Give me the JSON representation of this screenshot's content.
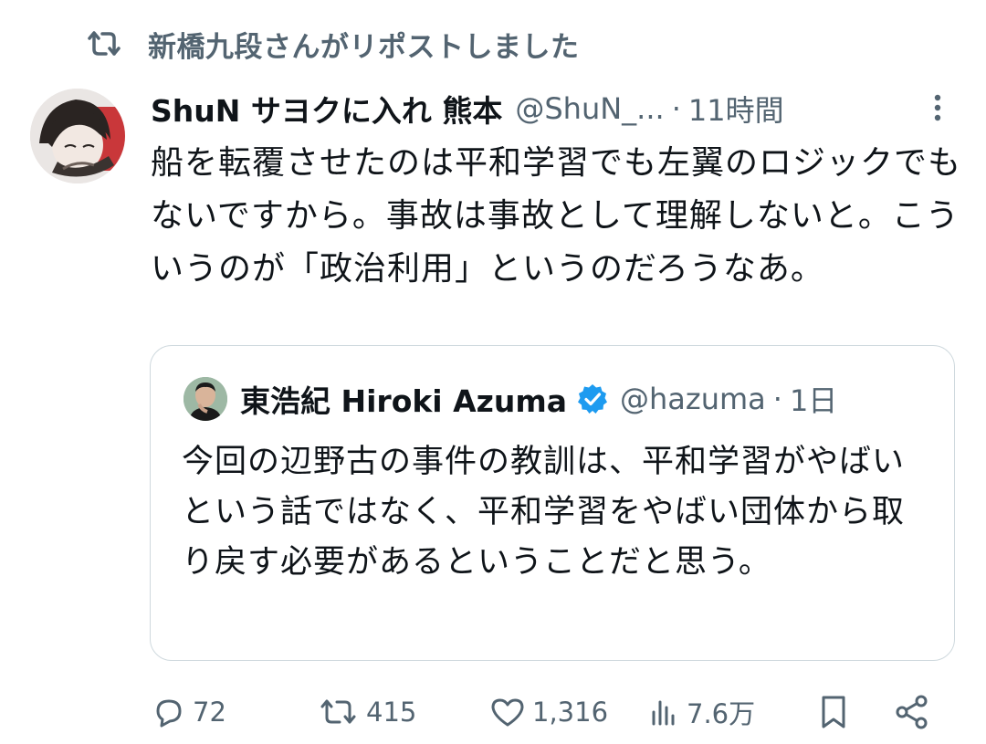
{
  "repost": {
    "icon": "repost-icon",
    "text": "新橋九段さんがリポストしました"
  },
  "tweet": {
    "display_name": "ShuN サヨクに入れ 熊本",
    "handle": "@ShuN_...",
    "separator": "·",
    "time": "11時間",
    "text": "船を転覆させたのは平和学習でも左翼のロジックでもないですから。事故は事故として理解しないと。こういうのが「政治利用」というのだろうなあ。"
  },
  "quote": {
    "display_name": "東浩紀 Hiroki Azuma",
    "verified": true,
    "handle": "@hazuma",
    "separator": "·",
    "time": "1日",
    "text": "今回の辺野古の事件の教訓は、平和学習がやばいという話ではなく、平和学習をやばい団体から取り戻す必要があるということだと思う。"
  },
  "actions": {
    "replies": "72",
    "reposts": "415",
    "likes": "1,316",
    "views": "7.6万"
  },
  "colors": {
    "text_primary": "#0f1419",
    "text_secondary": "#536471",
    "border": "#cfd9de",
    "verified_blue": "#1d9bf0"
  }
}
